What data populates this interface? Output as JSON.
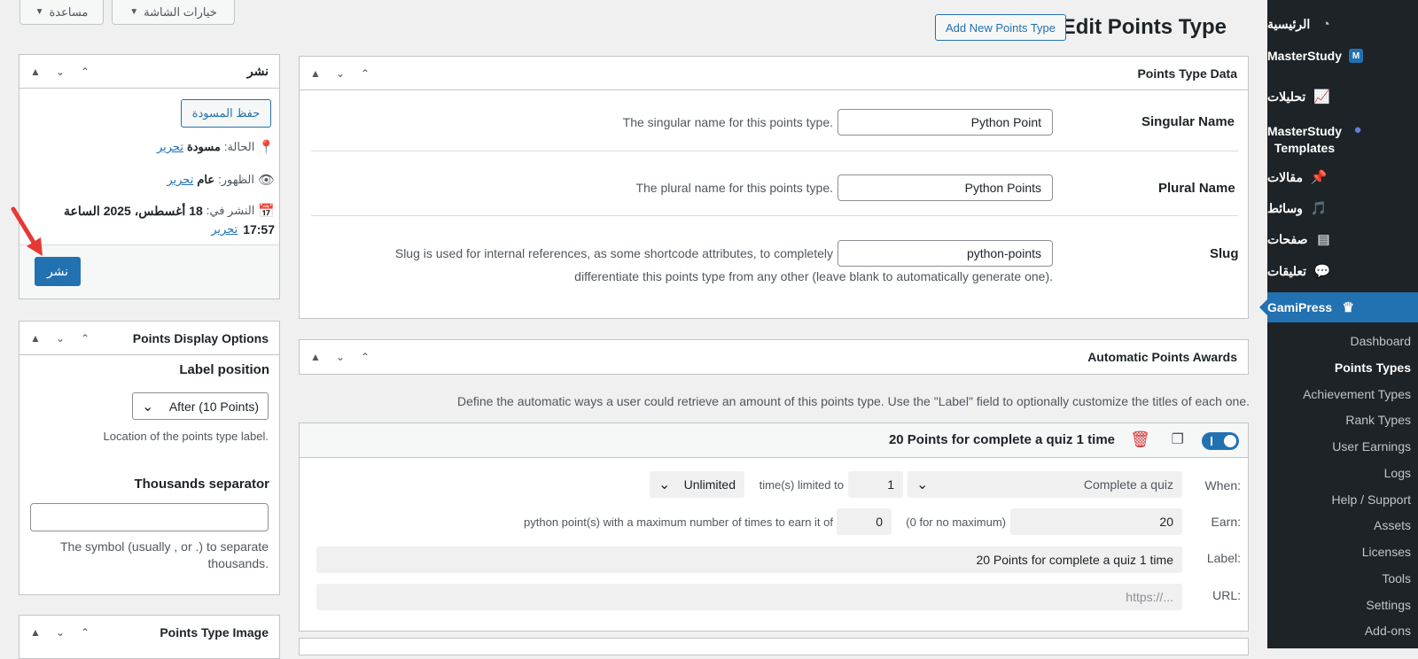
{
  "screen_options": {
    "help": "مساعدة",
    "options": "خيارات الشاشة"
  },
  "page": {
    "title": "Edit Points Type",
    "add_new": "Add New Points Type"
  },
  "menu": {
    "home": "الرئيسية",
    "masterstudy": "MasterStudy",
    "analytics": "تحليلات",
    "ms_templates_1": "MasterStudy",
    "ms_templates_2": "Templates",
    "posts": "مقالات",
    "media": "وسائط",
    "pages": "صفحات",
    "comments": "تعليقات",
    "gamipress": "GamiPress",
    "submenu": [
      "Dashboard",
      "Points Types",
      "Achievement Types",
      "Rank Types",
      "User Earnings",
      "Logs",
      "Help / Support",
      "Assets",
      "Licenses",
      "Tools",
      "Settings",
      "Add-ons"
    ]
  },
  "points_type_data": {
    "title": "Points Type Data",
    "singular_label": "Singular Name",
    "singular_value": "Python Point",
    "singular_desc": "The singular name for this points type.",
    "plural_label": "Plural Name",
    "plural_value": "Python Points",
    "plural_desc": "The plural name for this points type.",
    "slug_label": "Slug",
    "slug_value": "python-points",
    "slug_desc_1": "Slug is used for internal references, as some shortcode attributes, to completely",
    "slug_desc_2": "differentiate this points type from any other (leave blank to automatically generate one)."
  },
  "auto_awards": {
    "title": "Automatic Points Awards",
    "desc": "Define the automatic ways a user could retrieve an amount of this points type. Use the \"Label\" field to optionally customize the titles of each one.",
    "item_title": "20 Points for complete a quiz 1 time",
    "when_label": "When:",
    "when_value": "Complete a quiz",
    "times_value": "1",
    "times_text": "time(s) limited to",
    "limit_value": "Unlimited",
    "earn_label": "Earn:",
    "earn_value": "20",
    "max_hint": "(0 for no maximum)",
    "max_value": "0",
    "earn_text": "python point(s) with a maximum number of times to earn it of",
    "label_label": "Label:",
    "label_value": "20 Points for complete a quiz 1 time",
    "url_label": "URL:",
    "url_placeholder": "https://..."
  },
  "publish": {
    "title": "نشر",
    "save_draft": "حفظ المسودة",
    "status_label": "الحالة:",
    "status_value": "مسودة",
    "edit": "تحرير",
    "visibility_label": "الظهور:",
    "visibility_value": "عام",
    "date_label": "النشر في:",
    "date_value": "18 أغسطس، 2025 الساعة",
    "time_value": "17:57",
    "publish_btn": "نشر"
  },
  "display_options": {
    "title": "Points Display Options",
    "label_position": "Label position",
    "label_position_value": "After (10 Points)",
    "label_position_desc": "Location of the points type label.",
    "thousands": "Thousands separator",
    "thousands_desc_1": "The symbol (usually , or .) to separate",
    "thousands_desc_2": "thousands."
  },
  "image_box": {
    "title": "Points Type Image"
  },
  "colors": {
    "accent": "#2271b1",
    "sidebar": "#1d2327",
    "toggle": "#2271b1",
    "delete": "#d63638",
    "arrow": "#e53935"
  }
}
